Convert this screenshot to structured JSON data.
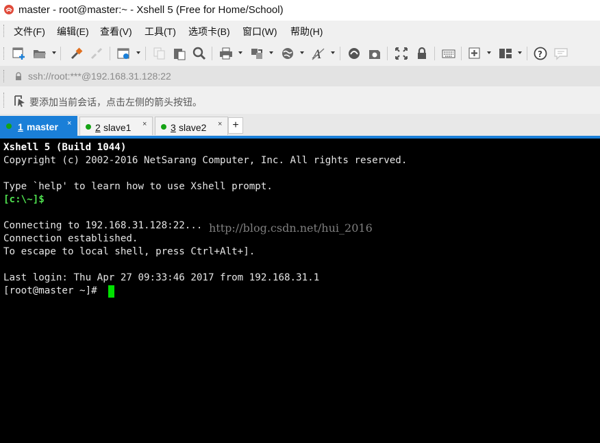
{
  "window": {
    "title": "master - root@master:~ - Xshell 5 (Free for Home/School)"
  },
  "menu": [
    "文件(F)",
    "编辑(E)",
    "查看(V)",
    "工具(T)",
    "选项卡(B)",
    "窗口(W)",
    "帮助(H)"
  ],
  "toolbar": {
    "icons": [
      "new-session-icon",
      "open-folder-icon",
      "connect-icon",
      "disconnect-icon",
      "properties-icon",
      "copy-icon",
      "paste-icon",
      "find-icon",
      "print-icon",
      "transfer-icon",
      "globe-icon",
      "font-icon",
      "xftp-icon",
      "xmanager-icon",
      "fullscreen-icon",
      "lock-icon",
      "keyboard-icon",
      "new-tab-icon",
      "layout-icon",
      "help-icon",
      "chat-icon"
    ]
  },
  "address": {
    "text": "ssh://root:***@192.168.31.128:22"
  },
  "hint": {
    "text": "要添加当前会话，点击左侧的箭头按钮。"
  },
  "tabs": [
    {
      "num": "1",
      "label": "master",
      "active": true
    },
    {
      "num": "2",
      "label": "slave1",
      "active": false
    },
    {
      "num": "3",
      "label": "slave2",
      "active": false
    }
  ],
  "add_tab_label": "+",
  "tab_close": "×",
  "terminal": {
    "lines": [
      "Xshell 5 (Build 1044)",
      "Copyright (c) 2002-2016 NetSarang Computer, Inc. All rights reserved.",
      "Type `help' to learn how to use Xshell prompt.",
      "[c:\\~]$",
      "Connecting to 192.168.31.128:22...",
      "Connection established.",
      "To escape to local shell, press Ctrl+Alt+].",
      "Last login: Thu Apr 27 09:33:46 2017 from 192.168.31.1",
      "[root@master ~]# "
    ]
  },
  "watermark": "http://blog.csdn.net/hui_2016",
  "colors": {
    "accent": "#1a7fd8",
    "status_dot": "#15a315",
    "cursor": "#00e000",
    "prompt_green": "#4fe04f"
  }
}
